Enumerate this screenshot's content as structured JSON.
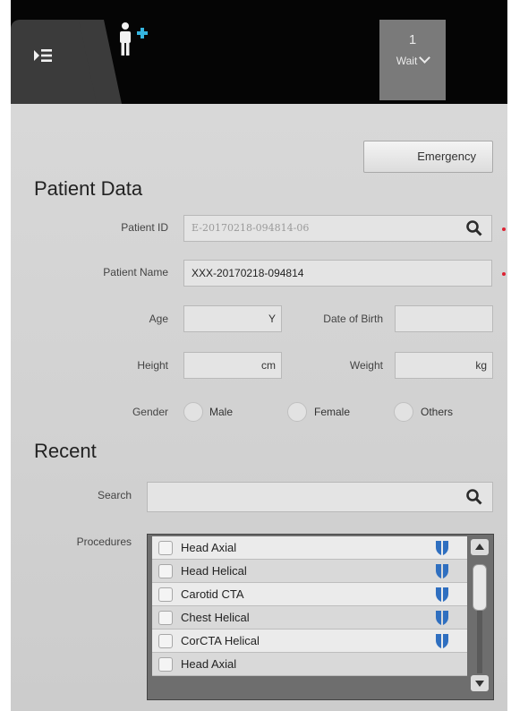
{
  "topbar": {
    "icons": {
      "list": "list-collapse-icon",
      "add_patient": "add-patient-icon"
    },
    "wait": {
      "count": "1",
      "label": "Wait"
    }
  },
  "emergency_label": "Emergency",
  "patient_data": {
    "title": "Patient Data",
    "patient_id": {
      "label": "Patient ID",
      "value": "E-20170218-094814-06"
    },
    "patient_name": {
      "label": "Patient Name",
      "value": "XXX-20170218-094814"
    },
    "age": {
      "label": "Age",
      "value": "",
      "unit": "Y"
    },
    "dob": {
      "label": "Date of Birth",
      "value": ""
    },
    "height": {
      "label": "Height",
      "value": "",
      "unit": "cm"
    },
    "weight": {
      "label": "Weight",
      "value": "",
      "unit": "kg"
    },
    "gender": {
      "label": "Gender",
      "options": [
        "Male",
        "Female",
        "Others"
      ]
    }
  },
  "recent": {
    "title": "Recent",
    "search_label": "Search",
    "search_value": "",
    "procedures_label": "Procedures",
    "procedures": [
      "Head Axial",
      "Head Helical",
      "Carotid CTA",
      "Chest Helical",
      "CorCTA Helical",
      "Head Axial"
    ]
  },
  "colors": {
    "accent": "#35b5e0",
    "shield": "#2f6fc0",
    "required": "#dd2233"
  }
}
